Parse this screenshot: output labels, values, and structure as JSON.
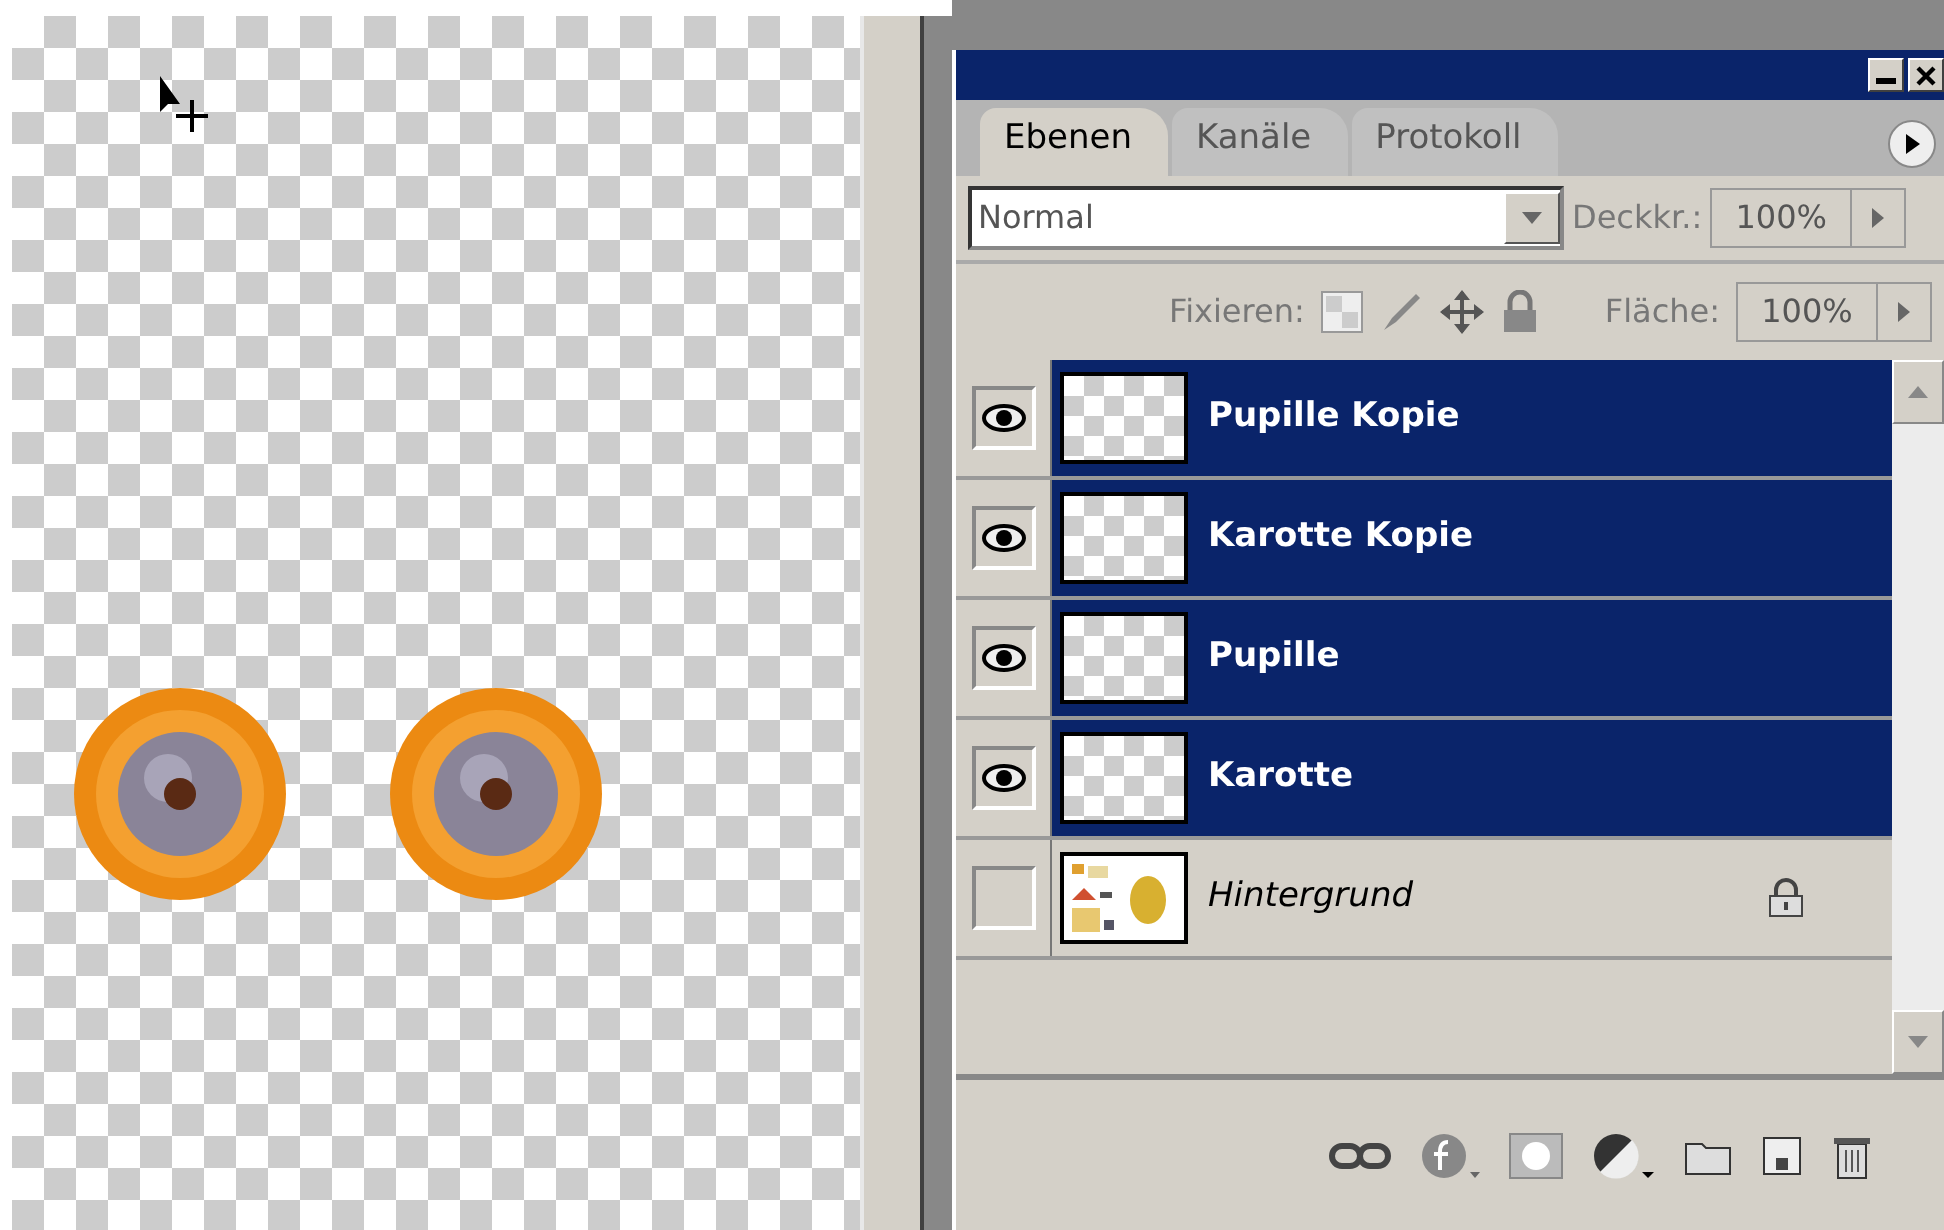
{
  "panel": {
    "tabs": [
      {
        "label": "Ebenen",
        "selected": true
      },
      {
        "label": "Kanäle",
        "selected": false
      },
      {
        "label": "Protokoll",
        "selected": false
      }
    ],
    "blend_mode": {
      "value": "Normal"
    },
    "opacity": {
      "label": "Deckkr.:",
      "value": "100%"
    },
    "lock": {
      "label": "Fixieren:"
    },
    "fill": {
      "label": "Fläche:",
      "value": "100%"
    },
    "layers": [
      {
        "name": "Pupille Kopie",
        "kind": "layer",
        "visible": true,
        "selected": true,
        "locked": false
      },
      {
        "name": "Karotte Kopie",
        "kind": "layer",
        "visible": true,
        "selected": true,
        "locked": false
      },
      {
        "name": "Pupille",
        "kind": "layer",
        "visible": true,
        "selected": true,
        "locked": false
      },
      {
        "name": "Karotte",
        "kind": "layer",
        "visible": true,
        "selected": true,
        "locked": false
      },
      {
        "name": "Hintergrund",
        "kind": "background",
        "visible": false,
        "selected": false,
        "locked": true
      }
    ]
  }
}
